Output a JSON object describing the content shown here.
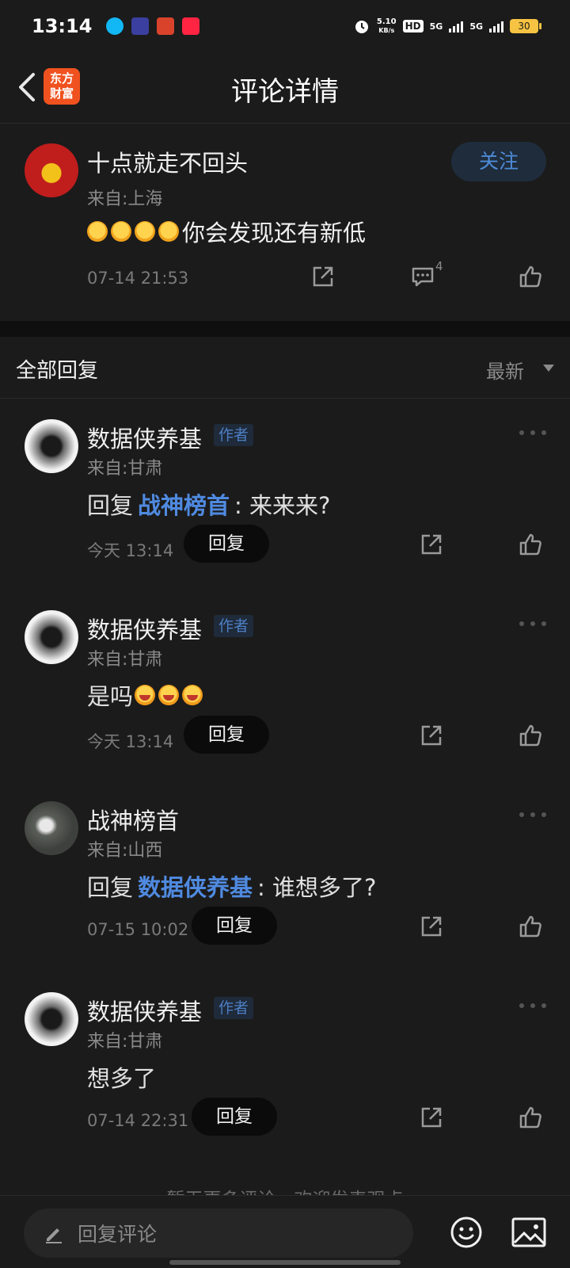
{
  "status_bar": {
    "time": "13:14",
    "net_speed": "5.10",
    "net_unit": "KB/s",
    "hd": "HD",
    "sim1": "5G",
    "sim2": "5G",
    "battery": "30"
  },
  "header": {
    "logo_line1": "东方",
    "logo_line2": "财富",
    "title": "评论详情"
  },
  "main_comment": {
    "author": "十点就走不回头",
    "location": "来自:上海",
    "text": "你会发现还有新低",
    "follow_label": "关注",
    "time": "07-14 21:53",
    "reply_count": "4"
  },
  "replies_header": {
    "title": "全部回复",
    "sort": "最新"
  },
  "replies": [
    {
      "author": "数据侠养基",
      "badge": "作者",
      "location": "来自:甘肃",
      "prefix": "回复",
      "mention": "战神榜首",
      "text": ": 来来来?",
      "time": "今天 13:14",
      "reply_label": "回复"
    },
    {
      "author": "数据侠养基",
      "badge": "作者",
      "location": "来自:甘肃",
      "text": "是吗",
      "time": "今天 13:14",
      "reply_label": "回复"
    },
    {
      "author": "战神榜首",
      "location": "来自:山西",
      "prefix": "回复",
      "mention": "数据侠养基",
      "text": ": 谁想多了?",
      "time": "07-15 10:02",
      "reply_label": "回复"
    },
    {
      "author": "数据侠养基",
      "badge": "作者",
      "location": "来自:甘肃",
      "text": "想多了",
      "time": "07-14 22:31",
      "reply_label": "回复"
    }
  ],
  "end_note": "暂无更多评论，欢迎发表观点",
  "bottom_bar": {
    "placeholder": "回复评论"
  }
}
